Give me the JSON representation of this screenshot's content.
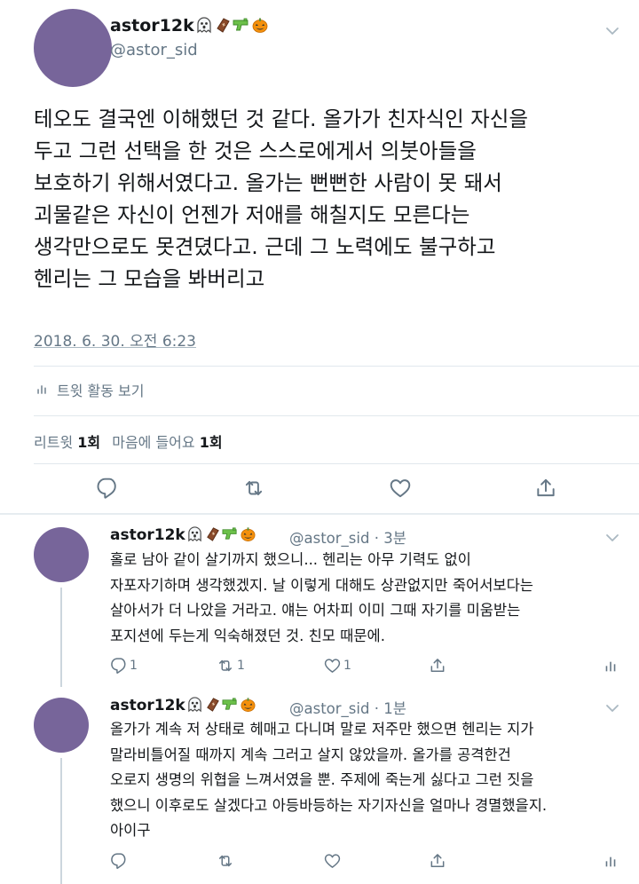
{
  "main_tweet": {
    "author_name": "astor12k",
    "author_emojis": [
      "ghost-emoji",
      "coffin-emoji",
      "water-pistol-emoji",
      "jack-o-lantern-emoji"
    ],
    "handle": "@astor_sid",
    "text": "테오도 결국엔 이해했던 것 같다. 올가가 친자식인 자신을\n두고 그런 선택을 한 것은 스스로에게서 의붓아들을\n보호하기 위해서였다고. 올가는 뻔뻔한 사람이 못 돼서\n괴물같은 자신이 언젠가 저애를 해칠지도 모른다는\n생각만으로도 못견뎠다고. 근데 그 노력에도 불구하고\n헨리는 그 모습을 봐버리고",
    "timestamp": "2018. 6. 30. 오전 6:23",
    "activity_label": "트윗 활동 보기",
    "retweet_label": "리트윗",
    "retweet_count": "1회",
    "like_label": "마음에 들어요",
    "like_count": "1회"
  },
  "replies": [
    {
      "author_name": "astor12k",
      "handle": "@astor_sid",
      "time": "3분",
      "text": "홀로 남아 같이 살기까지 했으니... 헨리는 아무 기력도 없이\n자포자기하며 생각했겠지. 날 이렇게 대해도 상관없지만 죽어서보다는\n살아서가 더 나았을 거라고. 얘는 어차피 이미 그때 자기를 미움받는\n포지션에 두는게 익숙해졌던 것. 친모 때문에.",
      "reply_count": "1",
      "retweet_count": "1",
      "like_count": "1"
    },
    {
      "author_name": "astor12k",
      "handle": "@astor_sid",
      "time": "1분",
      "text": "올가가 계속 저 상태로 헤매고 다니며 말로 저주만 했으면 헨리는 지가\n말라비틀어질 때까지 계속 그러고 살지 않았을까. 올가를 공격한건\n오로지 생명의 위협을 느껴서였을 뿐. 주제에 죽는게 싫다고 그런 짓을\n했으니 이후로도 살겠다고 아등바등하는 자기자신을 얼마나 경멸했을지.\n아이구",
      "reply_count": "",
      "retweet_count": "",
      "like_count": ""
    }
  ],
  "colors": {
    "avatar": "#77659a",
    "text_primary": "#14171a",
    "text_secondary": "#657786",
    "divider": "#e1e8ed"
  }
}
